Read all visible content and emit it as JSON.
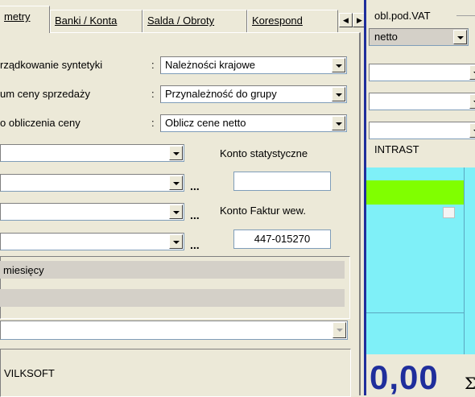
{
  "tabs": [
    {
      "label": "metry",
      "active": true
    },
    {
      "label": "Banki / Konta",
      "active": false
    },
    {
      "label": "Salda / Obroty",
      "active": false
    },
    {
      "label": "Korespond",
      "active": false
    }
  ],
  "tab_scroll": {
    "left": "◀",
    "right": "▶"
  },
  "form": {
    "rows": [
      {
        "label": "rządkowanie syntetyki",
        "colon": ":",
        "value": "Należności krajowe"
      },
      {
        "label": "um ceny sprzedaży",
        "colon": ":",
        "value": "Przynależność do grupy"
      },
      {
        "label": "o obliczenia ceny",
        "colon": ":",
        "value": "Oblicz cene netto"
      }
    ],
    "konto_statystyczne": {
      "label": "Konto statystyczne",
      "value": ""
    },
    "konto_faktur": {
      "label": "Konto  Faktur wew.",
      "value": "447-015270"
    },
    "dots": "...",
    "miesiecy_label": "miesięcy",
    "vendor_text": "VILKSOFT"
  },
  "right_window": {
    "vat_label": "obl.pod.VAT",
    "vat_value": "netto",
    "intrast_label": "INTRAST",
    "total_text": "0,00",
    "sigma": "Σ"
  },
  "colors": {
    "window_bg": "#ece9d8",
    "green_row": "#80ff00",
    "grid_bg": "#7ff0f8",
    "title_blue": "#1f2e9c"
  }
}
